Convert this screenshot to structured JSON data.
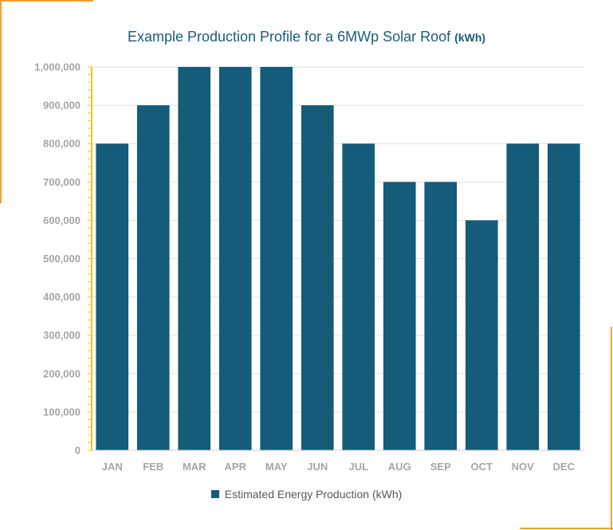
{
  "colors": {
    "bar": "#145C7A",
    "accent": "#F0A030",
    "axis_yellow": "#F5C518",
    "title": "#1B5E75",
    "grid": "#E2E2E2",
    "tick_text": "#A6A6A6"
  },
  "chart_data": {
    "type": "bar",
    "title": "Example Production Profile for a 6MWp Solar Roof",
    "title_unit": "(kWh)",
    "xlabel": "",
    "ylabel": "",
    "categories": [
      "JAN",
      "FEB",
      "MAR",
      "APR",
      "MAY",
      "JUN",
      "JUL",
      "AUG",
      "SEP",
      "OCT",
      "NOV",
      "DEC"
    ],
    "series": [
      {
        "name": "Estimated Energy Production (kWh)",
        "values": [
          800000,
          900000,
          1000000,
          1000000,
          1000000,
          900000,
          800000,
          700000,
          700000,
          600000,
          800000,
          800000
        ]
      }
    ],
    "ylim": [
      0,
      1000000
    ],
    "yticks": [
      0,
      100000,
      200000,
      300000,
      400000,
      500000,
      600000,
      700000,
      800000,
      900000,
      1000000
    ],
    "ytick_labels": [
      "0",
      "100,000",
      "200,000",
      "300,000",
      "400,000",
      "500,000",
      "600,000",
      "700,000",
      "800,000",
      "900,000",
      "1,000,000"
    ],
    "grid": true,
    "legend_position": "bottom"
  }
}
